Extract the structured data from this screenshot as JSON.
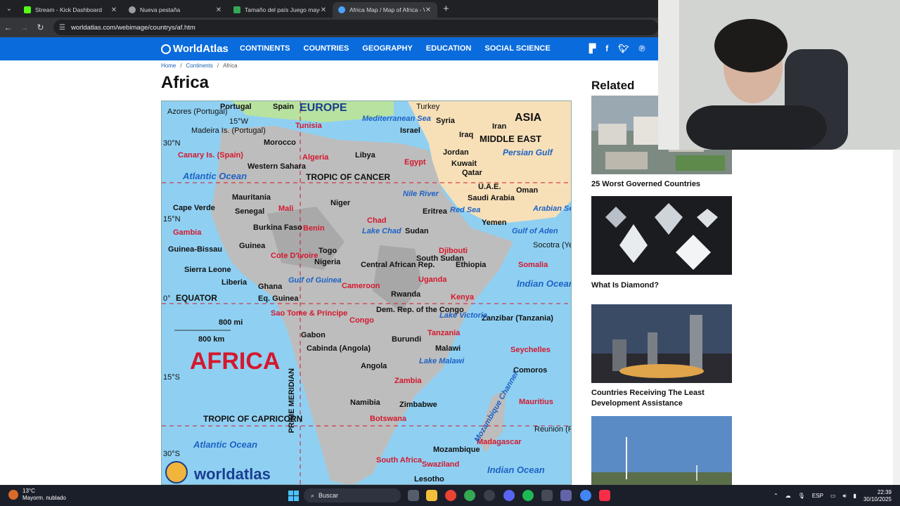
{
  "browser": {
    "tabs": [
      {
        "title": "Stream - Kick Dashboard",
        "fav_color": "#53fc18",
        "active": false
      },
      {
        "title": "Nueva pestaña",
        "fav_color": "#9aa0a6",
        "active": false
      },
      {
        "title": "Tamaño del país Juego mayor o...",
        "fav_color": "#34a853",
        "active": false
      },
      {
        "title": "Africa Map / Map of Africa - Wo...",
        "fav_color": "#4aa3ff",
        "active": true
      }
    ],
    "url": "worldatlas.com/webimage/countrys/af.htm"
  },
  "site": {
    "logo": "WorldAtlas",
    "nav": [
      "CONTINENTS",
      "COUNTRIES",
      "GEOGRAPHY",
      "EDUCATION",
      "SOCIAL SCIENCE"
    ],
    "breadcrumb": [
      "Home",
      "Continents",
      "Africa"
    ],
    "title": "Africa"
  },
  "map": {
    "labels": {
      "europe": "EUROPE",
      "asia": "ASIA",
      "middle_east": "MIDDLE EAST",
      "africa": "AFRICA",
      "tropic_cancer": "TROPIC OF CANCER",
      "tropic_capricorn": "TROPIC OF CAPRICORN",
      "equator": "EQUATOR",
      "prime_meridian": "PRIME MERIDIAN",
      "scale_mi": "800 mi",
      "scale_km": "800 km",
      "lat_30n": "30°N",
      "lat_15n": "15°N",
      "lat_0": "0°",
      "lat_15s": "15°S",
      "lat_30s": "30°S",
      "lon_15w": "15°W",
      "brand": "worldatlas"
    },
    "countries": [
      "Azores (Portugal)",
      "Portugal",
      "Spain",
      "Madeira Is. (Portugal)",
      "Morocco",
      "Tunisia",
      "Canary Is. (Spain)",
      "Algeria",
      "Libya",
      "Egypt",
      "Western Sahara",
      "Mauritania",
      "Mali",
      "Niger",
      "Chad",
      "Sudan",
      "Eritrea",
      "Cape Verde",
      "Senegal",
      "Gambia",
      "Burkina Faso",
      "Benin",
      "Guinea-Bissau",
      "Guinea",
      "Cote D'Ivoire",
      "Togo",
      "Nigeria",
      "Sierra Leone",
      "Liberia",
      "Ghana",
      "Central African Rep.",
      "South Sudan",
      "Djibouti",
      "Ethiopia",
      "Somalia",
      "Cameroon",
      "Eq. Guinea",
      "Uganda",
      "Rwanda",
      "Kenya",
      "Sao Tome & Principe",
      "Gabon",
      "Congo",
      "Dem. Rep. of the Congo",
      "Burundi",
      "Tanzania",
      "Zanzibar (Tanzania)",
      "Cabinda (Angola)",
      "Angola",
      "Malawi",
      "Seychelles",
      "Comoros",
      "Zambia",
      "Namibia",
      "Zimbabwe",
      "Botswana",
      "Mozambique",
      "Madagascar",
      "Mauritius",
      "Reunion (France)",
      "South Africa",
      "Swaziland",
      "Lesotho",
      "Turkey",
      "Syria",
      "Israel",
      "Iraq",
      "Iran",
      "Jordan",
      "Kuwait",
      "Qatar",
      "U.A.E.",
      "Oman",
      "Saudi Arabia",
      "Yemen",
      "Socotra (Yemen)"
    ],
    "waters": [
      "Mediterranean Sea",
      "Atlantic Ocean",
      "Nile River",
      "Red Sea",
      "Persian Gulf",
      "Arabian Sea",
      "Gulf of Aden",
      "Lake Chad",
      "Gulf of Guinea",
      "Lake Victoria",
      "Lake Malawi",
      "Indian Ocean",
      "Mozambique Channel",
      "Atlantic Ocean",
      "Indian Ocean"
    ]
  },
  "related": {
    "heading": "Related",
    "items": [
      {
        "caption": "25 Worst Governed Countries"
      },
      {
        "caption": "What Is Diamond?"
      },
      {
        "caption": "Countries Receiving The Least Development Assistance"
      },
      {
        "caption": ""
      }
    ]
  },
  "taskbar": {
    "temp": "13°C",
    "weather": "Mayorm. nublado",
    "search": "Buscar",
    "lang": "ESP",
    "time": "22:39",
    "date": "30/10/2025"
  }
}
